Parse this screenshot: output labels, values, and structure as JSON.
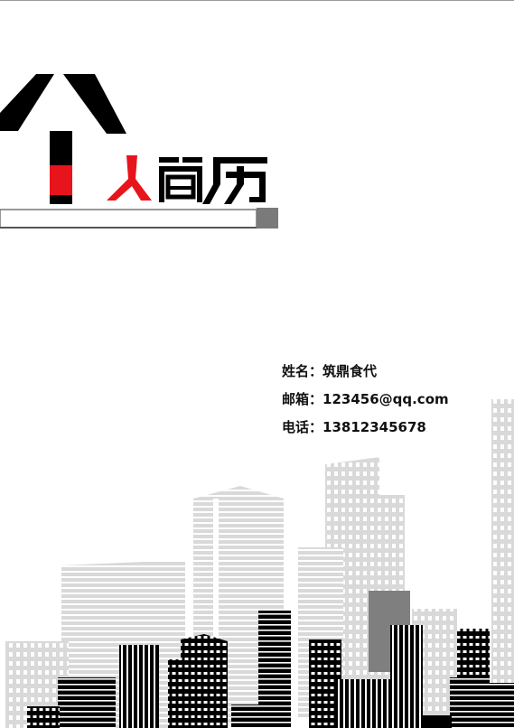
{
  "document": {
    "title_graphic_text": "个人简历"
  },
  "contact": {
    "name_label": "姓名：",
    "name_value": "筑鼎食代",
    "email_label": "邮箱：",
    "email_value": "123456@qq.com",
    "phone_label": "电话：",
    "phone_value": "13812345678"
  },
  "colors": {
    "accent_red": "#e8141b",
    "black": "#000000",
    "light_gray": "#d9d9d9",
    "mid_gray": "#808080"
  }
}
